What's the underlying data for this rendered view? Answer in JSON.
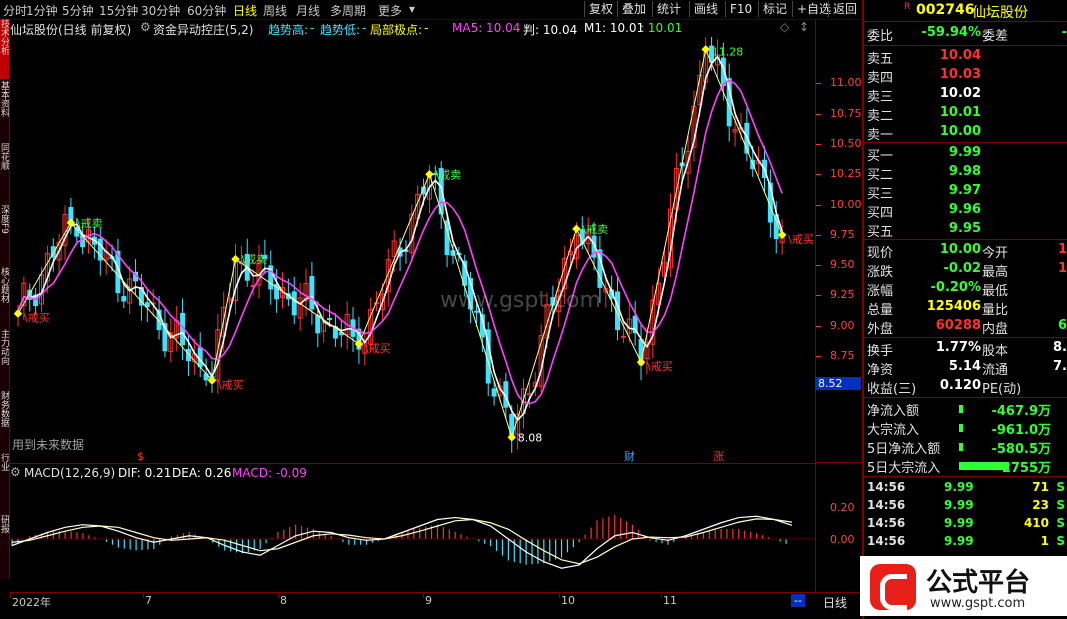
{
  "topbar": {
    "timeframes": [
      "分时",
      "1分钟",
      "5分钟",
      "15分钟",
      "30分钟",
      "60分钟",
      "日线",
      "周线",
      "月线",
      "多周期",
      "更多"
    ],
    "active": "日线",
    "tools": [
      "复权",
      "叠加",
      "统计",
      "画线",
      "F10",
      "标记",
      "+自选",
      "返回"
    ]
  },
  "leftstrip": [
    "技术分析",
    "基本资料",
    "同花顺",
    "深度F9",
    "核心题材",
    "主力动向",
    "财务数据",
    "行业",
    "研报"
  ],
  "info": {
    "title": "仙坛股份(日线 前复权)",
    "indicator": "资金异动控庄(5,2)",
    "trend_high": "趋势高:",
    "trend_low": "趋势低:",
    "local_extreme": "局部极点:",
    "dash": "-",
    "ma5": "MA5: 10.04",
    "judge": "判: 10.04",
    "m1": "M1: 10.01",
    "extra": ": 10.01"
  },
  "price_axis": [
    "11.00",
    "10.75",
    "10.50",
    "10.25",
    "10.00",
    "9.75",
    "9.50",
    "9.25",
    "9.00",
    "8.75",
    "8.50"
  ],
  "current_price_tag": "8.52",
  "chart_labels": {
    "sell": "\\戒卖",
    "buy": "\\戒买",
    "high": "11.28",
    "low": "8.08",
    "future_data": "用到未来数据",
    "marker_s": "$",
    "marker_cai": "财",
    "marker_zhang": "涨"
  },
  "macd": {
    "label": "MACD(12,26,9)",
    "dif": "DIF: 0.21",
    "dea": "DEA: 0.26",
    "macd": "MACD: -0.09",
    "axis": [
      "0.20",
      "0.00"
    ]
  },
  "time_axis": [
    "2022年",
    "7",
    "8",
    "9",
    "10",
    "11"
  ],
  "time_axis_end": "--",
  "period_label": "日线",
  "stock": {
    "badge": "R",
    "code": "002746",
    "name": "仙坛股份",
    "weibi_label": "委比",
    "weibi": "-59.94%",
    "weicha_label": "委差",
    "weicha": "-",
    "asks": [
      {
        "label": "卖五",
        "price": "10.04",
        "color": "red"
      },
      {
        "label": "卖四",
        "price": "10.03",
        "color": "red"
      },
      {
        "label": "卖三",
        "price": "10.02",
        "color": "white"
      },
      {
        "label": "卖二",
        "price": "10.01",
        "color": "green"
      },
      {
        "label": "卖一",
        "price": "10.00",
        "color": "green"
      }
    ],
    "bids": [
      {
        "label": "买一",
        "price": "9.99",
        "color": "green"
      },
      {
        "label": "买二",
        "price": "9.98",
        "color": "green"
      },
      {
        "label": "买三",
        "price": "9.97",
        "color": "green"
      },
      {
        "label": "买四",
        "price": "9.96",
        "color": "green"
      },
      {
        "label": "买五",
        "price": "9.95",
        "color": "green"
      }
    ],
    "quote": [
      {
        "k": "现价",
        "v": "10.00",
        "vc": "green",
        "k2": "今开",
        "v2": "1",
        "v2c": "red"
      },
      {
        "k": "涨跌",
        "v": "-0.02",
        "vc": "green",
        "k2": "最高",
        "v2": "1",
        "v2c": "red"
      },
      {
        "k": "涨幅",
        "v": "-0.20%",
        "vc": "green",
        "k2": "最低",
        "v2": "",
        "v2c": "green"
      },
      {
        "k": "总量",
        "v": "125406",
        "vc": "yellow",
        "k2": "量比",
        "v2": "",
        "v2c": "white"
      },
      {
        "k": "外盘",
        "v": "60288",
        "vc": "red",
        "k2": "内盘",
        "v2": "6",
        "v2c": "green"
      }
    ],
    "finance": [
      {
        "k": "换手",
        "v": "1.77%",
        "vc": "white",
        "k2": "股本",
        "v2": "8.",
        "v2c": "white"
      },
      {
        "k": "净资",
        "v": "5.14",
        "vc": "white",
        "k2": "流通",
        "v2": "7.",
        "v2c": "white"
      },
      {
        "k": "收益(三)",
        "v": "0.120",
        "vc": "white",
        "k2": "PE(动)",
        "v2": "",
        "v2c": "white"
      }
    ],
    "flows": [
      {
        "k": "净流入额",
        "v": "-467.9万"
      },
      {
        "k": "大宗流入",
        "v": "-961.0万"
      },
      {
        "k": "5日净流入额",
        "v": "-580.5万"
      },
      {
        "k": "5日大宗流入",
        "v": "-2755万"
      }
    ],
    "ticks": [
      {
        "time": "14:56",
        "price": "9.99",
        "vol": "71",
        "side": "S"
      },
      {
        "time": "14:56",
        "price": "9.99",
        "vol": "23",
        "side": "S"
      },
      {
        "time": "14:56",
        "price": "9.99",
        "vol": "410",
        "side": "S"
      },
      {
        "time": "14:56",
        "price": "9.99",
        "vol": "1",
        "side": "S"
      }
    ]
  },
  "watermark": "www.gspt.com",
  "logo": {
    "text": "公式平台",
    "url": "www.gspt.com"
  },
  "colors": {
    "up": "#ff3030",
    "down": "#40e0ff",
    "ma5": "#ffffff",
    "m1": "#ff40ff",
    "zigzag": "#ffff80",
    "border": "#800000"
  },
  "chart_data": {
    "type": "line",
    "ylim": [
      8.0,
      11.3
    ],
    "zigzag": [
      [
        0,
        9.1
      ],
      [
        9,
        9.85
      ],
      [
        33,
        8.55
      ],
      [
        37,
        9.55
      ],
      [
        58,
        8.85
      ],
      [
        70,
        10.25
      ],
      [
        84,
        8.08
      ],
      [
        95,
        9.8
      ],
      [
        106,
        8.7
      ],
      [
        117,
        11.28
      ],
      [
        130,
        9.75
      ]
    ],
    "candles_n": 131,
    "seed_close": [
      8.7,
      8.8,
      8.9,
      9.1,
      9.3,
      9.5,
      9.6,
      9.7,
      9.8,
      9.7,
      9.6,
      9.5,
      9.55,
      9.6,
      9.5,
      9.4,
      9.3,
      9.35,
      9.4,
      9.3,
      9.2,
      9.1,
      9.15,
      9.2,
      9.1,
      9.0,
      9.05,
      9.1,
      9.0,
      8.9,
      8.8,
      8.7,
      8.6,
      8.55,
      8.8,
      9.1,
      9.4,
      9.5,
      9.3,
      9.1,
      9.0,
      8.95,
      9.0,
      8.9,
      8.85,
      8.9,
      8.95,
      9.0,
      9.2,
      9.4,
      9.6,
      9.8,
      9.9,
      10.0,
      10.1,
      10.2,
      10.25,
      10.1,
      10.0,
      10.1,
      10.05,
      9.9,
      9.7,
      9.5,
      9.3,
      9.2,
      9.0,
      8.8,
      8.6,
      8.4,
      8.2,
      8.1,
      8.08,
      8.3,
      8.6,
      9.0,
      9.4,
      9.7,
      9.8,
      9.6,
      9.4,
      9.2,
      9.0,
      8.85,
      8.7,
      8.9,
      9.1,
      9.3,
      9.5,
      9.7,
      9.9,
      10.1,
      10.4,
      10.8,
      11.1,
      11.28,
      10.9,
      10.6,
      10.4,
      10.3,
      10.2,
      10.1,
      10.0,
      9.9,
      9.8,
      9.75,
      9.85,
      9.95,
      10.0
    ],
    "macd_dif": [
      -0.1,
      0.0,
      0.1,
      0.18,
      0.22,
      0.2,
      0.12,
      0.02,
      -0.05,
      0.0,
      0.05,
      0.02,
      -0.1,
      -0.2,
      -0.25,
      -0.1,
      0.05,
      0.12,
      0.1,
      0.02,
      -0.02,
      0.0,
      0.1,
      0.2,
      0.3,
      0.33,
      0.3,
      0.2,
      0.0,
      -0.2,
      -0.35,
      -0.45,
      -0.4,
      -0.15,
      0.05,
      0.1,
      0.02,
      -0.02,
      0.05,
      0.15,
      0.25,
      0.33,
      0.35,
      0.3,
      0.21
    ],
    "macd_dea": [
      -0.05,
      -0.02,
      0.05,
      0.12,
      0.18,
      0.2,
      0.18,
      0.1,
      0.02,
      -0.02,
      0.0,
      0.02,
      -0.02,
      -0.1,
      -0.18,
      -0.15,
      -0.05,
      0.05,
      0.08,
      0.06,
      0.02,
      0.0,
      0.05,
      0.12,
      0.2,
      0.28,
      0.3,
      0.25,
      0.15,
      -0.02,
      -0.18,
      -0.32,
      -0.38,
      -0.28,
      -0.12,
      0.0,
      0.03,
      0.02,
      0.03,
      0.1,
      0.18,
      0.26,
      0.31,
      0.3,
      0.26
    ]
  }
}
